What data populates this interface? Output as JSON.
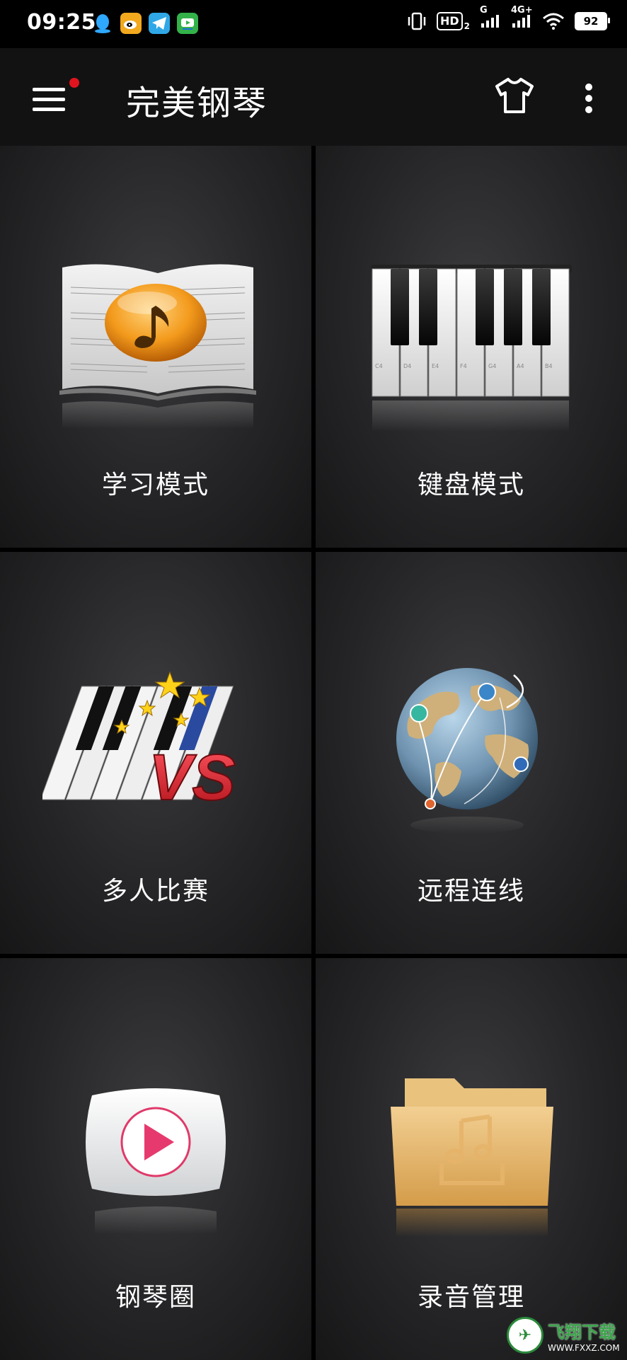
{
  "status_bar": {
    "time": "09:25",
    "icons_left": [
      "qq-icon",
      "weibo-icon",
      "telegram-icon",
      "video-app-icon"
    ],
    "hd": "HD",
    "hd_sub": "2",
    "network_1": "G",
    "network_2": "4G+",
    "battery": "92"
  },
  "app_bar": {
    "title": "完美钢琴",
    "has_notification_dot": true
  },
  "tiles": [
    {
      "label": "学习模式",
      "icon": "music-book-icon"
    },
    {
      "label": "键盘模式",
      "icon": "piano-keys-icon"
    },
    {
      "label": "多人比赛",
      "icon": "piano-vs-icon"
    },
    {
      "label": "远程连线",
      "icon": "globe-connect-icon"
    },
    {
      "label": "钢琴圈",
      "icon": "play-circle-icon"
    },
    {
      "label": "录音管理",
      "icon": "music-folder-icon"
    }
  ],
  "piano_key_labels": [
    "C4",
    "D4",
    "E4",
    "F4",
    "G4",
    "A4",
    "B4"
  ],
  "watermark": {
    "main": "飞翔下载",
    "sub": "WWW.FXXZ.COM"
  },
  "colors": {
    "notification_dot": "#e0141e",
    "app_bar_bg": "#121212",
    "vs_red": "#e3262e",
    "folder_gold": "#e7b871"
  }
}
